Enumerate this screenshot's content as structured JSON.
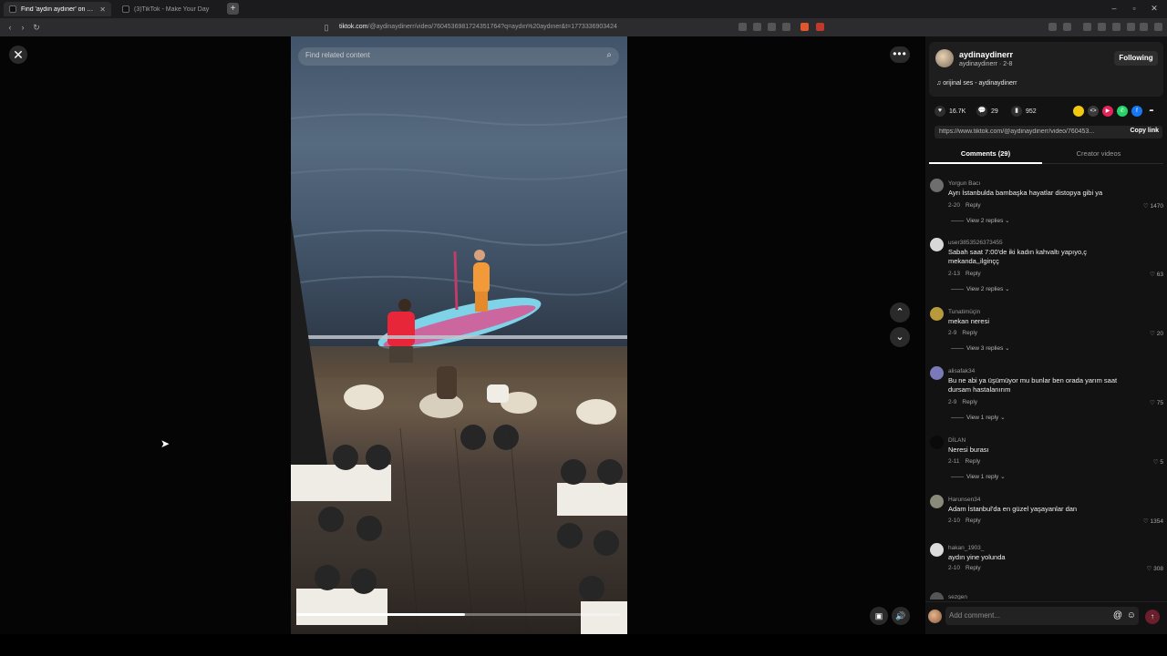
{
  "browser": {
    "tabs": [
      {
        "title": "Find 'aydın aydıner' on TikTok",
        "active": true
      },
      {
        "title": "(3)TikTok - Make Your Day",
        "active": false
      }
    ],
    "url_host": "tiktok.com",
    "url_path": "/@aydinaydinerr/video/7604536981724351764?q=aydın%20aydıner&t=1773336903424"
  },
  "video": {
    "search_placeholder": "Find related content",
    "progress_fraction": 0.52,
    "time_label": ""
  },
  "author": {
    "display_name": "aydinaydinerr",
    "sub_line": "aydinaydinerr · 2-8",
    "follow_label": "Following",
    "music": "orijinal ses - aydinaydinerr"
  },
  "stats": {
    "likes": "16.7K",
    "comments": "29",
    "saves": "952"
  },
  "share_colors": [
    "#f2c811",
    "#3a3a3a",
    "#e3245a",
    "#25d366",
    "#1877f2"
  ],
  "link": {
    "url": "https://www.tiktok.com/@aydinaydinerr/video/760453...",
    "copy_label": "Copy link"
  },
  "panel_tabs": [
    {
      "label": "Comments (29)",
      "active": true
    },
    {
      "label": "Creator videos",
      "active": false
    }
  ],
  "comments": [
    {
      "user": "Yorgun Bacı",
      "text": "Ayrı İstanbulda bambaşka hayatlar distopya gibi ya",
      "date": "2-20",
      "likes": "1470",
      "replies": "View 2 replies",
      "avatar_color": "#6e6e6e"
    },
    {
      "user": "user3853526373455",
      "text": "Sabah saat 7:00'de iki kadın kahvaltı yapıyo,ç mekanda,,ilginçç",
      "date": "2-13",
      "likes": "63",
      "replies": "View 2 replies",
      "avatar_color": "#d8d8d8"
    },
    {
      "user": "Tunatimüçin",
      "text": "mekan neresi",
      "date": "2-9",
      "likes": "20",
      "replies": "View 3 replies",
      "avatar_color": "#b89a3c"
    },
    {
      "user": "alisafak34",
      "text": "Bu ne abi ya üşümüyor mu bunlar ben orada yarım saat dursam hastalanırım",
      "date": "2-9",
      "likes": "75",
      "replies": "View 1 reply",
      "avatar_color": "#7a7ab8"
    },
    {
      "user": "DİLAN",
      "text": "Neresi burası",
      "date": "2-11",
      "likes": "5",
      "replies": "View 1 reply",
      "avatar_color": "#0a0a0a"
    },
    {
      "user": "Harunsen34",
      "text": "Adam İstanbul'da en güzel yaşayanlar dan",
      "date": "2-10",
      "likes": "1354",
      "replies": "",
      "avatar_color": "#8a8a7a"
    },
    {
      "user": "hakan_1903_",
      "text": "aydın yine yolunda",
      "date": "2-10",
      "likes": "308",
      "replies": "",
      "avatar_color": "#dcdcdc"
    },
    {
      "user": "sezgen",
      "text": "",
      "date": "",
      "likes": "",
      "replies": "",
      "avatar_color": "#555555"
    }
  ],
  "reply_label": "Reply",
  "add_comment_placeholder": "Add comment...",
  "icons": {
    "close": "close-icon",
    "more": "more-dots-icon",
    "up": "chevron-up-icon",
    "down": "chevron-down-icon",
    "volume": "volume-icon",
    "miniplayer": "miniplayer-icon"
  }
}
